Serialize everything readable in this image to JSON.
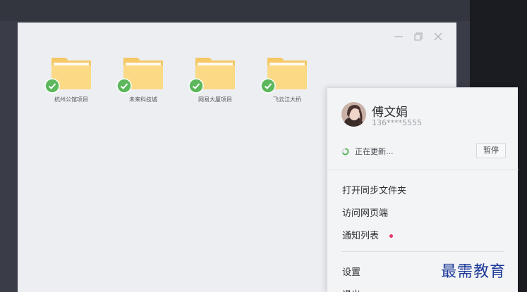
{
  "window": {
    "controls": {
      "minimize": "minimize-icon",
      "restore": "restore-icon",
      "close": "close-icon"
    }
  },
  "folders": [
    {
      "label": "杭州公馆项目",
      "status": "synced"
    },
    {
      "label": "未来科技城",
      "status": "synced"
    },
    {
      "label": "网易大厦项目",
      "status": "synced"
    },
    {
      "label": "飞云江大桥",
      "status": "synced"
    }
  ],
  "popup": {
    "user_name": "傅文娟",
    "user_phone": "136****5555",
    "status_text": "正在更新...",
    "pause_label": "暂停",
    "menu": {
      "open_sync_folder": "打开同步文件夹",
      "visit_web": "访问网页端",
      "notify_list": "通知列表",
      "settings": "设置",
      "logout": "退出"
    }
  },
  "watermark": "最需教育",
  "colors": {
    "folder": "#fbd985",
    "folder_back": "#f5c866",
    "check": "#5cb85c",
    "notify_dot": "#e8336b",
    "watermark": "#1e3a9a"
  }
}
